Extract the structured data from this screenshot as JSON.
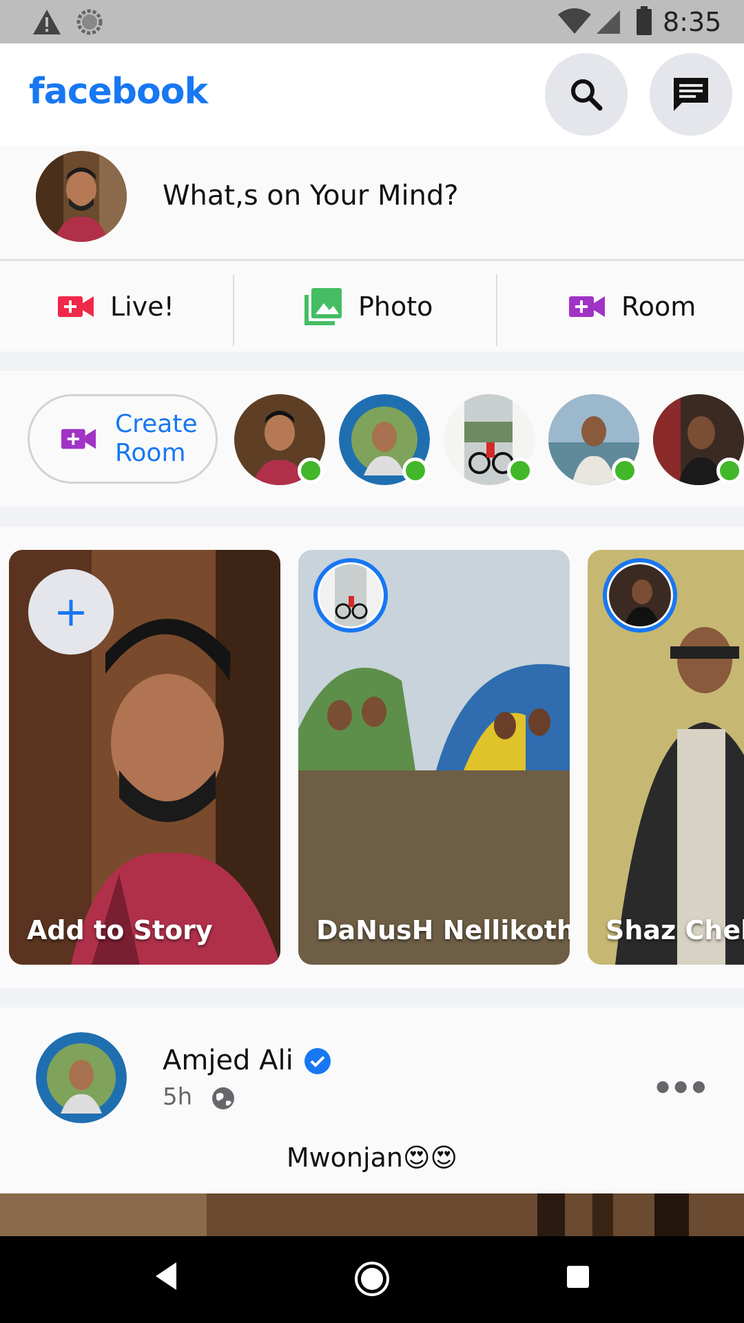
{
  "status_bar": {
    "time": "8:35",
    "icons": [
      "warning-icon",
      "sync-icon",
      "wifi-icon",
      "signal-icon",
      "battery-icon"
    ]
  },
  "header": {
    "logo": "facebook",
    "brand_color": "#1877f2",
    "buttons": [
      "search-icon",
      "messenger-icon"
    ]
  },
  "composer": {
    "placeholder": "What,s on Your Mind?"
  },
  "actions": {
    "live_label": "Live!",
    "photo_label": "Photo",
    "room_label": "Room",
    "live_color": "#f02849",
    "photo_color": "#45bd62",
    "room_color": "#a033c5"
  },
  "rooms": {
    "create_line1": "Create",
    "create_line2": "Room",
    "online_color": "#42b72a"
  },
  "stories": [
    {
      "label": "Add to Story"
    },
    {
      "label": "DaNusH Nellikoth"
    },
    {
      "label": "Shaz Chelsea"
    }
  ],
  "post": {
    "author": "Amjed Ali",
    "time": "5h",
    "text": "Mwonjan😍😍"
  },
  "nav": [
    "back-icon",
    "home-icon",
    "recents-icon"
  ]
}
